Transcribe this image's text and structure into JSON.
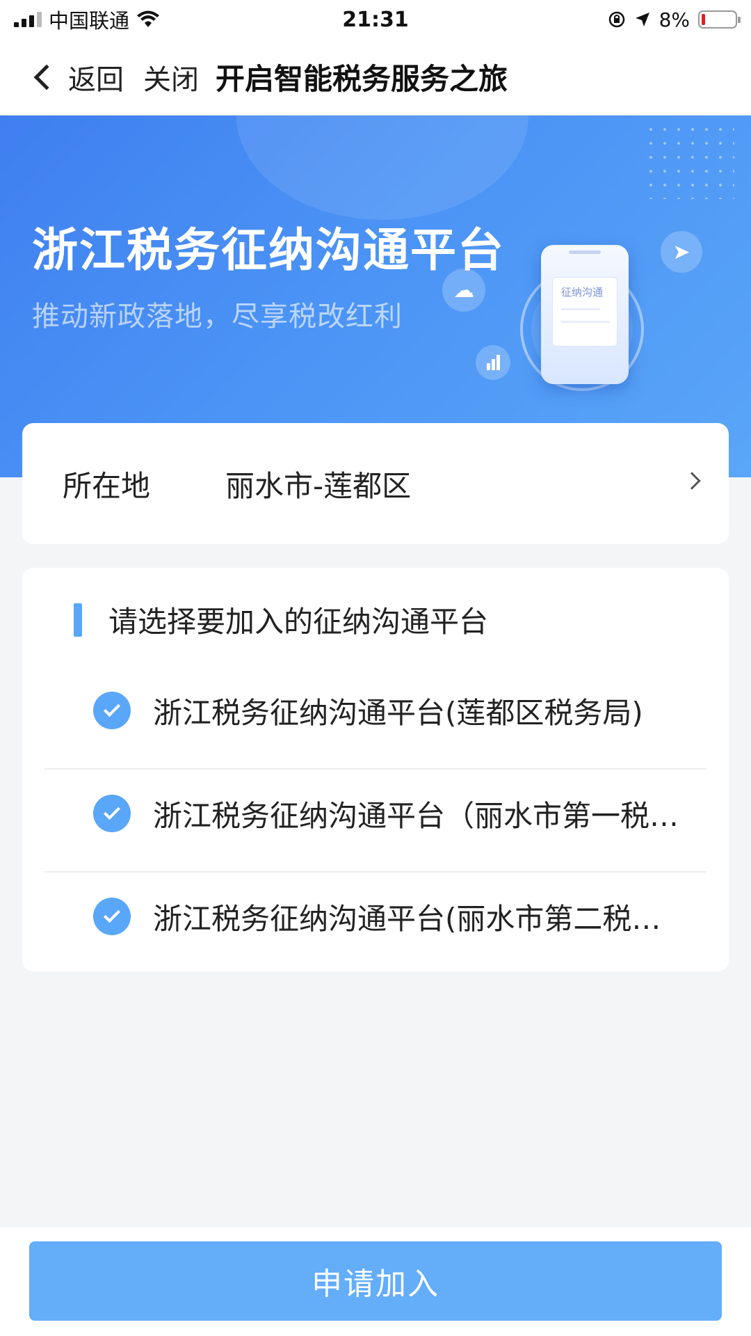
{
  "status_bar": {
    "carrier": "中国联通",
    "time": "21:31",
    "battery": "8%",
    "icons": [
      "signal-icon",
      "wifi-icon",
      "orientation-lock-icon",
      "location-arrow-icon",
      "battery-icon"
    ]
  },
  "nav": {
    "back_label": "返回",
    "close_label": "关闭",
    "title": "开启智能税务服务之旅"
  },
  "banner": {
    "title": "浙江税务征纳沟通平台",
    "subtitle": "推动新政落地，尽享税改红利",
    "phone_label": "征纳沟通"
  },
  "location": {
    "label": "所在地",
    "value": "丽水市-莲都区"
  },
  "platforms": {
    "title": "请选择要加入的征纳沟通平台",
    "items": [
      {
        "label": "浙江税务征纳沟通平台(莲都区税务局)",
        "checked": true
      },
      {
        "label": "浙江税务征纳沟通平台（丽水市第一税…",
        "checked": true
      },
      {
        "label": "浙江税务征纳沟通平台(丽水市第二税…",
        "checked": true
      }
    ]
  },
  "actions": {
    "apply_label": "申请加入"
  },
  "colors": {
    "accent": "#5aa6f8",
    "banner_start": "#3f7ff0",
    "button": "#63adf9",
    "battery_low": "#e02020"
  }
}
